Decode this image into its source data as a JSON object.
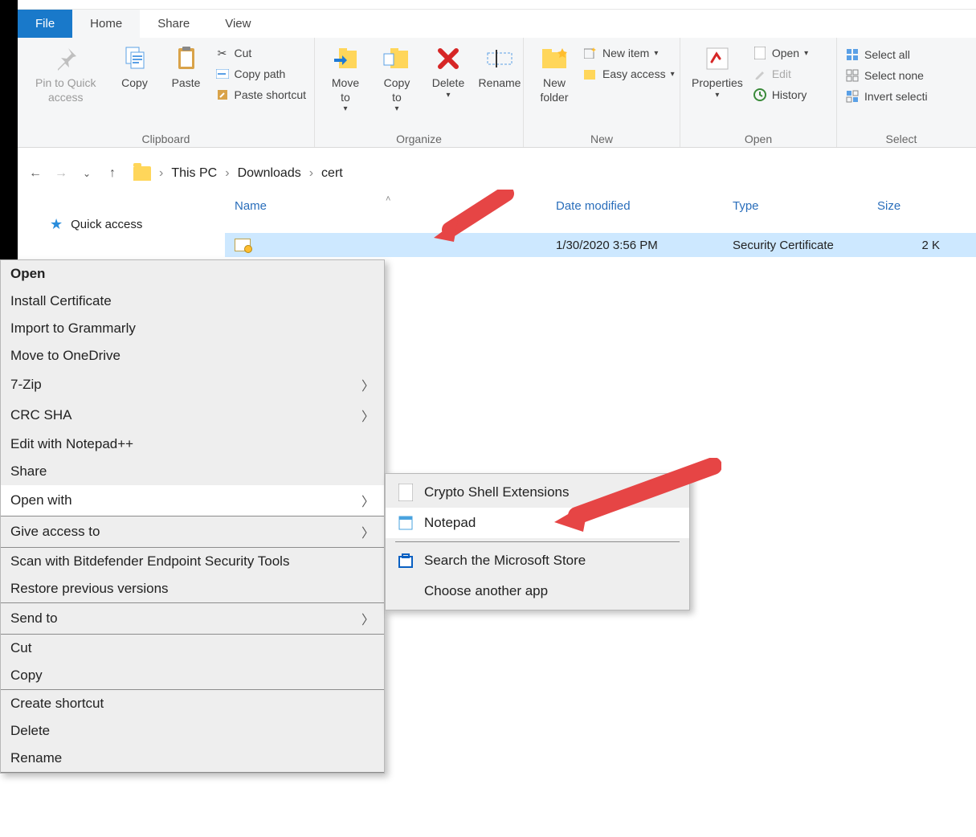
{
  "tabs": {
    "file": "File",
    "home": "Home",
    "share": "Share",
    "view": "View"
  },
  "ribbon": {
    "clipboard": {
      "label": "Clipboard",
      "pin": "Pin to Quick access",
      "copy": "Copy",
      "paste": "Paste",
      "cut": "Cut",
      "copypath": "Copy path",
      "pasteshortcut": "Paste shortcut"
    },
    "organize": {
      "label": "Organize",
      "moveto": "Move to",
      "copyto": "Copy to",
      "delete": "Delete",
      "rename": "Rename"
    },
    "new": {
      "label": "New",
      "newfolder": "New folder",
      "newitem": "New item",
      "easyaccess": "Easy access"
    },
    "open": {
      "label": "Open",
      "properties": "Properties",
      "open": "Open",
      "edit": "Edit",
      "history": "History"
    },
    "select": {
      "label": "Select",
      "all": "Select all",
      "none": "Select none",
      "invert": "Invert selecti"
    }
  },
  "breadcrumb": {
    "pc": "This PC",
    "dl": "Downloads",
    "cert": "cert"
  },
  "columns": {
    "name": "Name",
    "date": "Date modified",
    "type": "Type",
    "size": "Size"
  },
  "nav": {
    "quick": "Quick access"
  },
  "file": {
    "name": "",
    "date": "1/30/2020 3:56 PM",
    "type": "Security Certificate",
    "size": "2 K"
  },
  "ctx": {
    "open": "Open",
    "install": "Install Certificate",
    "grammarly": "Import to Grammarly",
    "onedrive": "Move to OneDrive",
    "sevenzip": "7-Zip",
    "crc": "CRC SHA",
    "npp": "Edit with Notepad++",
    "share": "Share",
    "openwith": "Open with",
    "giveaccess": "Give access to",
    "bitdefender": "Scan with Bitdefender Endpoint Security Tools",
    "restore": "Restore previous versions",
    "sendto": "Send to",
    "cut": "Cut",
    "copy": "Copy",
    "shortcut": "Create shortcut",
    "delete": "Delete",
    "rename": "Rename"
  },
  "sub": {
    "crypto": "Crypto Shell Extensions",
    "notepad": "Notepad",
    "store": "Search the Microsoft Store",
    "choose": "Choose another app"
  }
}
